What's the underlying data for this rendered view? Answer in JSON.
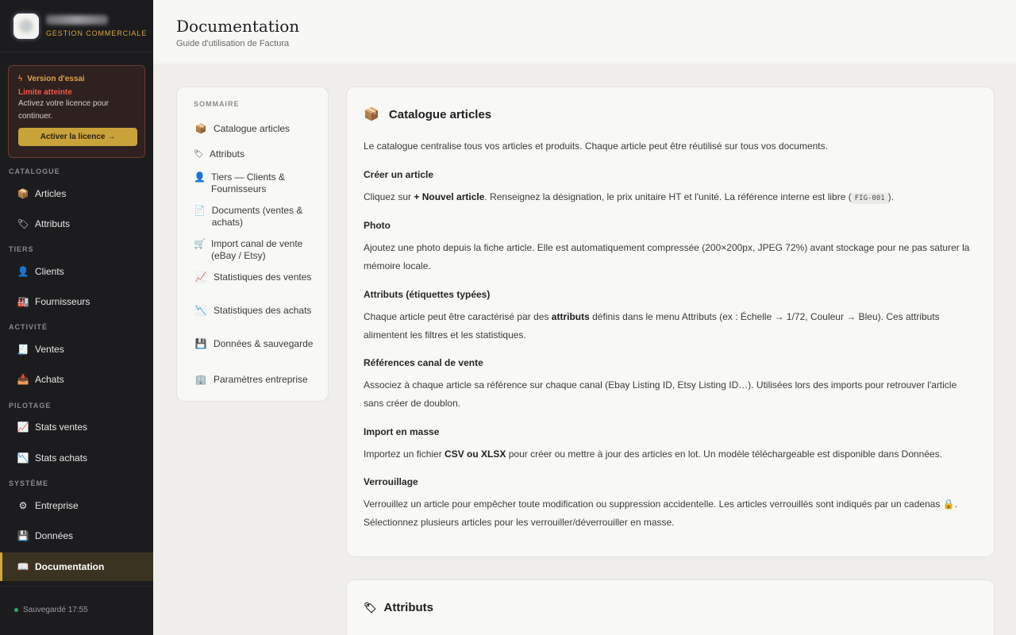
{
  "brand": {
    "subtitle": "GESTION COMMERCIALE"
  },
  "trial": {
    "title": "Version d'essai",
    "limit": "Limite atteinte",
    "message": "Activez votre licence pour continuer.",
    "button": "Activer la licence →"
  },
  "nav": {
    "sections": [
      "CATALOGUE",
      "TIERS",
      "ACTIVITÉ",
      "PILOTAGE",
      "SYSTÈME"
    ],
    "items": [
      {
        "label": "Articles",
        "icon": "package-icon"
      },
      {
        "label": "Attributs",
        "icon": "tag-icon"
      },
      {
        "label": "Clients",
        "icon": "person-icon"
      },
      {
        "label": "Fournisseurs",
        "icon": "factory-icon"
      },
      {
        "label": "Ventes",
        "icon": "receipt-icon"
      },
      {
        "label": "Achats",
        "icon": "inbox-icon"
      },
      {
        "label": "Stats ventes",
        "icon": "chart-up-icon"
      },
      {
        "label": "Stats achats",
        "icon": "chart-down-icon"
      },
      {
        "label": "Entreprise",
        "icon": "gear-icon"
      },
      {
        "label": "Données",
        "icon": "floppy-icon"
      },
      {
        "label": "Documentation",
        "icon": "book-icon",
        "active": true
      }
    ],
    "saved": "Sauvegardé 17:55"
  },
  "header": {
    "title": "Documentation",
    "subtitle": "Guide d'utilisation de Factura"
  },
  "toc": {
    "heading": "SOMMAIRE",
    "items": [
      {
        "label": "Catalogue articles",
        "icon": "package-icon"
      },
      {
        "label": "Attributs",
        "icon": "tag-icon"
      },
      {
        "label": "Tiers — Clients & Fournisseurs",
        "icon": "person-icon"
      },
      {
        "label": "Documents (ventes & achats)",
        "icon": "document-icon"
      },
      {
        "label": "Import canal de vente (eBay / Etsy)",
        "icon": "cart-icon"
      },
      {
        "label": "Statistiques des ventes",
        "icon": "chart-up-icon"
      },
      {
        "label": "Statistiques des achats",
        "icon": "chart-down-icon"
      },
      {
        "label": "Données & sauvegarde",
        "icon": "floppy-icon"
      },
      {
        "label": "Paramètres entreprise",
        "icon": "building-icon"
      }
    ]
  },
  "catalogue": {
    "title": "Catalogue articles",
    "intro": "Le catalogue centralise tous vos articles et produits. Chaque article peut être réutilisé sur tous vos documents.",
    "s1_title": "Créer un article",
    "s1_a": "Cliquez sur ",
    "s1_b": "+ Nouvel article",
    "s1_c": ". Renseignez la désignation, le prix unitaire HT et l'unité. La référence interne est libre (",
    "s1_code": "FIG-001",
    "s1_d": ").",
    "s2_title": "Photo",
    "s2_text": "Ajoutez une photo depuis la fiche article. Elle est automatiquement compressée (200×200px, JPEG 72%) avant stockage pour ne pas saturer la mémoire locale.",
    "s3_title": "Attributs (étiquettes typées)",
    "s3_a": "Chaque article peut être caractérisé par des ",
    "s3_b": "attributs",
    "s3_c": " définis dans le menu Attributs (ex : Échelle → 1/72, Couleur → Bleu). Ces attributs alimentent les filtres et les statistiques.",
    "s4_title": "Références canal de vente",
    "s4_text": "Associez à chaque article sa référence sur chaque canal (Ebay Listing ID, Etsy Listing ID…). Utilisées lors des imports pour retrouver l'article sans créer de doublon.",
    "s5_title": "Import en masse",
    "s5_a": "Importez un fichier ",
    "s5_b": "CSV ou XLSX",
    "s5_c": " pour créer ou mettre à jour des articles en lot. Un modèle téléchargeable est disponible dans Données.",
    "s6_title": "Verrouillage",
    "s6_a": "Verrouillez un article pour empêcher toute modification ou suppression accidentelle. Les articles verrouillés sont indiqués par un cadenas ",
    "s6_lock": "🔒",
    "s6_b": ". Sélectionnez plusieurs articles pour les verrouiller/déverrouiller en masse."
  },
  "attributs": {
    "title": "Attributs"
  }
}
